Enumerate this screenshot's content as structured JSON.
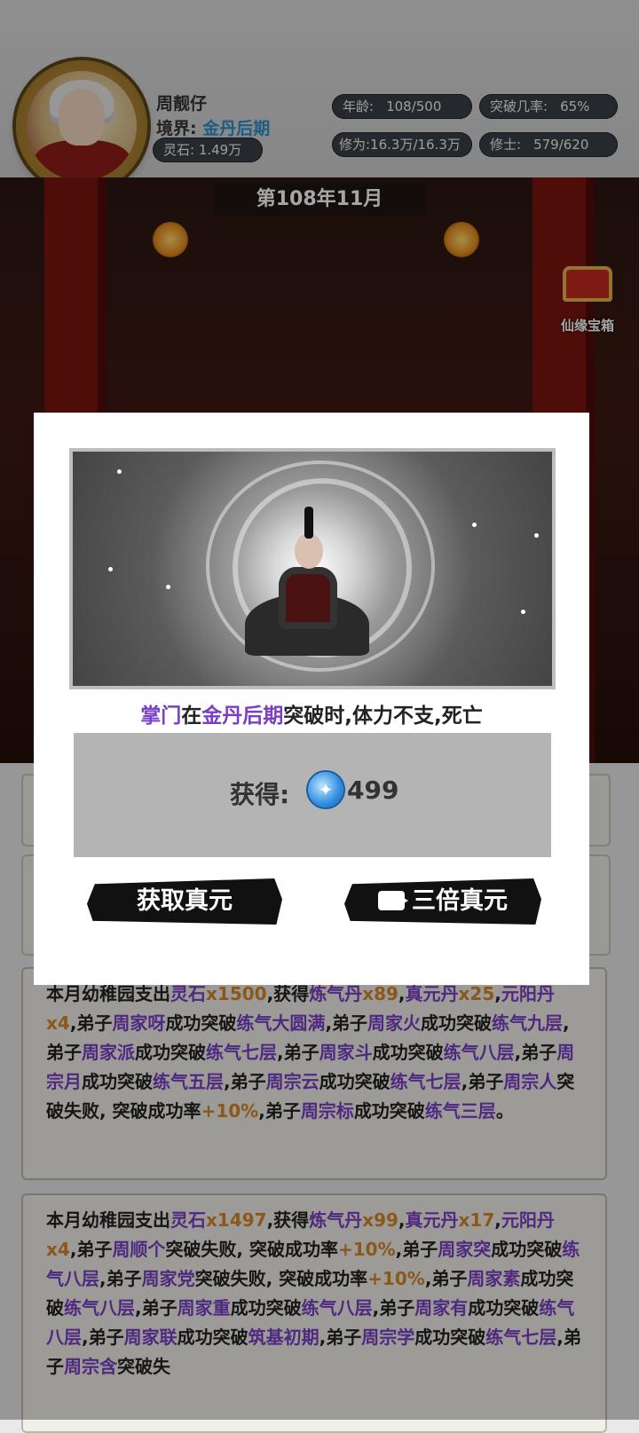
{
  "header": {
    "player_name": "周靓仔",
    "realm_label": "境界:",
    "realm_value": "金丹后期",
    "spirit_stone": "灵石: 1.49万",
    "age_label": "年龄:",
    "age_value": "108/500",
    "breakthrough_label": "突破几率:",
    "breakthrough_value": "65%",
    "cultivation": "修为:16.3万/16.3万",
    "disciples_label": "修士:",
    "disciples_value": "579/620"
  },
  "scene": {
    "date": "第108年11月",
    "chest_label": "仙缘宝箱"
  },
  "modal": {
    "msg_part1": "掌门",
    "msg_part2": "在",
    "msg_part3": "金丹后期",
    "msg_part4": "突破时,体力不支,死亡",
    "reward_label": "获得:",
    "reward_value": "499",
    "get_button": "获取真元",
    "triple_button": "三倍真元"
  },
  "log": [
    {
      "segments": [
        [
          "本月幼稚园支出",
          ""
        ],
        [
          "灵石",
          "p"
        ],
        [
          "x1500",
          "o"
        ],
        [
          ",获得",
          ""
        ],
        [
          "炼气丹",
          "p"
        ],
        [
          "x89",
          "o"
        ],
        [
          ",",
          ""
        ],
        [
          "真元丹",
          "p"
        ],
        [
          "x25",
          "o"
        ],
        [
          ",",
          ""
        ],
        [
          "元阳丹",
          "p"
        ],
        [
          "x4",
          "o"
        ],
        [
          ",弟子",
          ""
        ],
        [
          "周家呀",
          "p"
        ],
        [
          "成功突破",
          ""
        ],
        [
          "练气大圆满",
          "p"
        ],
        [
          ",弟子",
          ""
        ],
        [
          "周家火",
          "p"
        ],
        [
          "成功突破",
          ""
        ],
        [
          "练气九层",
          "p"
        ],
        [
          ",弟子",
          ""
        ],
        [
          "周家派",
          "p"
        ],
        [
          "成功突破",
          ""
        ],
        [
          "练气七层",
          "p"
        ],
        [
          ",弟子",
          ""
        ],
        [
          "周家斗",
          "p"
        ],
        [
          "成功突破",
          ""
        ],
        [
          "练气八层",
          "p"
        ],
        [
          ",弟子",
          ""
        ],
        [
          "周宗月",
          "p"
        ],
        [
          "成功突破",
          ""
        ],
        [
          "练气五层",
          "p"
        ],
        [
          ",弟子",
          ""
        ],
        [
          "周宗云",
          "p"
        ],
        [
          "成功突破",
          ""
        ],
        [
          "练气七层",
          "p"
        ],
        [
          ",弟子",
          ""
        ],
        [
          "周宗人",
          "p"
        ],
        [
          "突破失败, 突破成功率",
          ""
        ],
        [
          "+10%",
          "o"
        ],
        [
          ",弟子",
          ""
        ],
        [
          "周宗标",
          "p"
        ],
        [
          "成功突破",
          ""
        ],
        [
          "练气三层",
          "p"
        ],
        [
          "。",
          ""
        ]
      ]
    },
    {
      "segments": [
        [
          "本月幼稚园支出",
          ""
        ],
        [
          "灵石",
          "p"
        ],
        [
          "x1497",
          "o"
        ],
        [
          ",获得",
          ""
        ],
        [
          "炼气丹",
          "p"
        ],
        [
          "x99",
          "o"
        ],
        [
          ",",
          ""
        ],
        [
          "真元丹",
          "p"
        ],
        [
          "x17",
          "o"
        ],
        [
          ",",
          ""
        ],
        [
          "元阳丹",
          "p"
        ],
        [
          "x4",
          "o"
        ],
        [
          ",弟子",
          ""
        ],
        [
          "周顺个",
          "p"
        ],
        [
          "突破失败, 突破成功率",
          ""
        ],
        [
          "+10%",
          "o"
        ],
        [
          ",弟子",
          ""
        ],
        [
          "周家突",
          "p"
        ],
        [
          "成功突破",
          ""
        ],
        [
          "练气八层",
          "p"
        ],
        [
          ",弟子",
          ""
        ],
        [
          "周家党",
          "p"
        ],
        [
          "突破失败, 突破成功率",
          ""
        ],
        [
          "+10%",
          "o"
        ],
        [
          ",弟子",
          ""
        ],
        [
          "周家素",
          "p"
        ],
        [
          "成功突破",
          ""
        ],
        [
          "练气八层",
          "p"
        ],
        [
          ",弟子",
          ""
        ],
        [
          "周家重",
          "p"
        ],
        [
          "成功突破",
          ""
        ],
        [
          "练气八层",
          "p"
        ],
        [
          ",弟子",
          ""
        ],
        [
          "周家有",
          "p"
        ],
        [
          "成功突破",
          ""
        ],
        [
          "练气八层",
          "p"
        ],
        [
          ",弟子",
          ""
        ],
        [
          "周家联",
          "p"
        ],
        [
          "成功突破",
          ""
        ],
        [
          "筑基初期",
          "p"
        ],
        [
          ",弟子",
          ""
        ],
        [
          "周宗学",
          "p"
        ],
        [
          "成功突破",
          ""
        ],
        [
          "练气七层",
          "p"
        ],
        [
          ",弟子",
          ""
        ],
        [
          "周宗含",
          "p"
        ],
        [
          "突破失",
          ""
        ]
      ]
    }
  ]
}
